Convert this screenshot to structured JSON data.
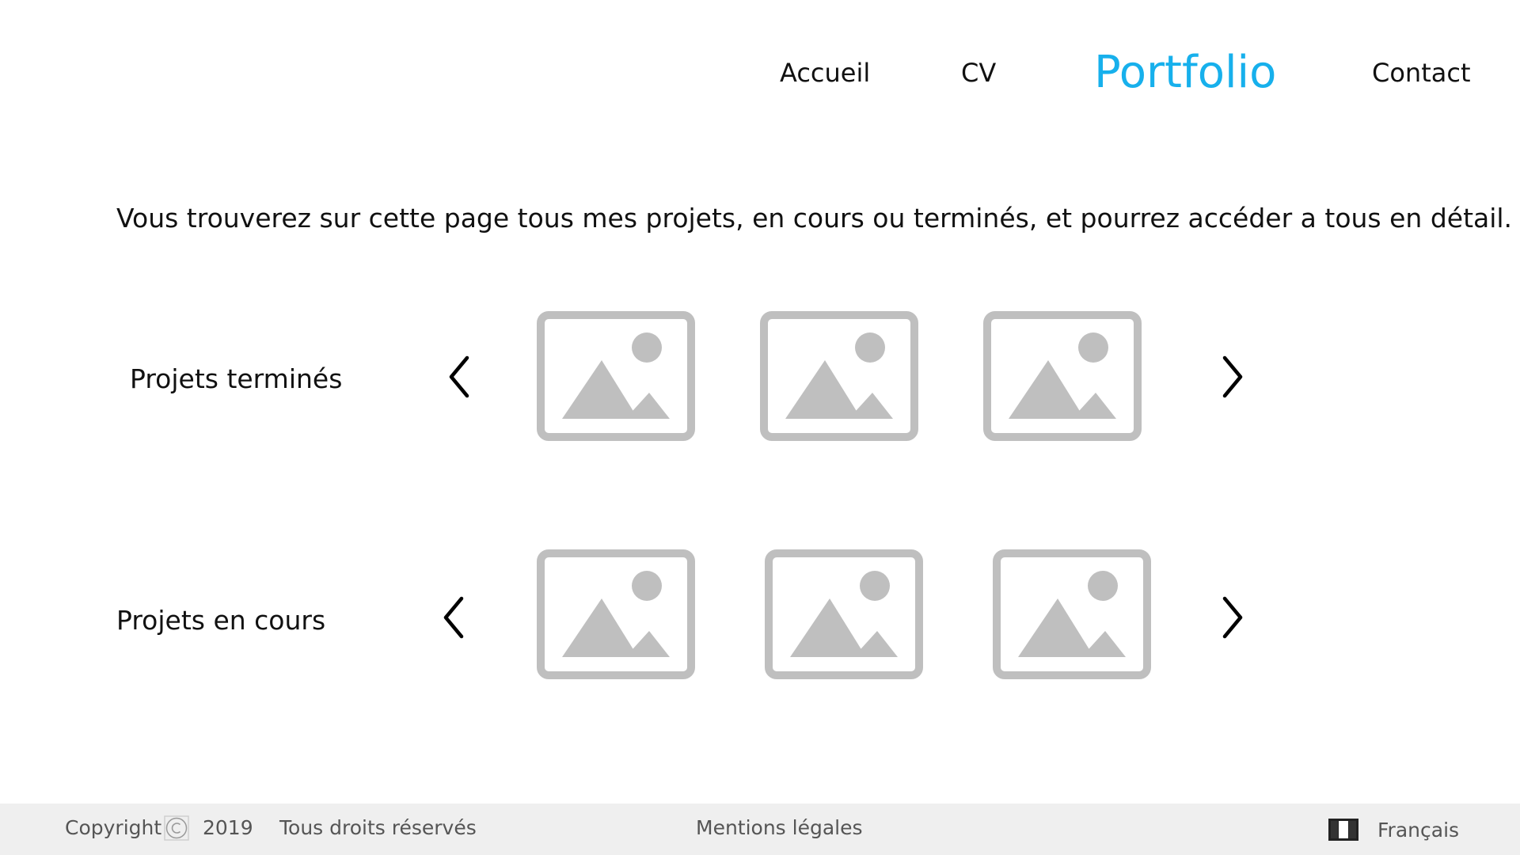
{
  "nav": {
    "items": [
      {
        "label": "Accueil"
      },
      {
        "label": "CV"
      },
      {
        "label": "Portfolio"
      },
      {
        "label": "Contact"
      }
    ],
    "active": "Portfolio",
    "active_color": "#17b0ec"
  },
  "intro": {
    "text": "Vous trouverez sur cette page tous mes projets, en cours ou terminés, et pourrez accéder a tous en détail."
  },
  "sections": [
    {
      "label": "Projets terminés",
      "prev_icon": "chevron-left-icon",
      "next_icon": "chevron-right-icon",
      "thumbnails": [
        "image-placeholder-icon",
        "image-placeholder-icon",
        "image-placeholder-icon"
      ]
    },
    {
      "label": "Projets en cours",
      "prev_icon": "chevron-left-icon",
      "next_icon": "chevron-right-icon",
      "thumbnails": [
        "image-placeholder-icon",
        "image-placeholder-icon",
        "image-placeholder-icon"
      ]
    }
  ],
  "footer": {
    "copyright": "Copyright",
    "copyright_icon": "copyright-icon",
    "year": "2019",
    "rights": "Tous droits réservés",
    "legal": "Mentions légales",
    "flag_icon": "french-flag-icon",
    "language": "Français",
    "background": "#efefef"
  },
  "colors": {
    "placeholder": "#bfbfbf",
    "text": "#111111",
    "footer_text": "#555555"
  }
}
